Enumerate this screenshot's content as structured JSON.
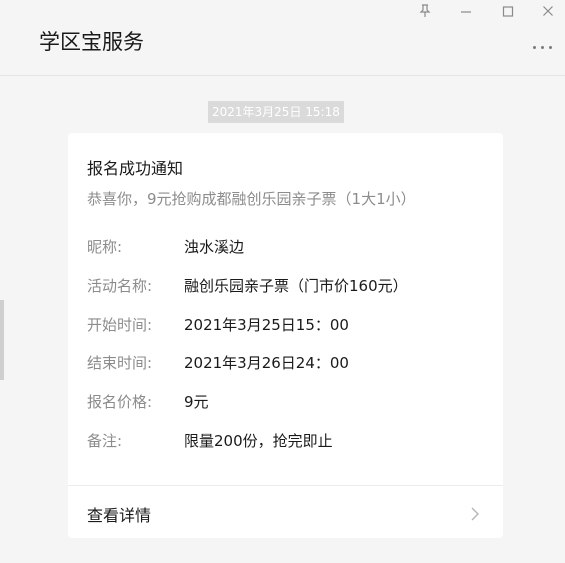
{
  "window": {
    "title": "学区宝服务",
    "controls": [
      "pin-icon",
      "minimize-icon",
      "maximize-icon",
      "close-icon"
    ]
  },
  "message": {
    "timestamp": "2021年3月25日 15:18",
    "card": {
      "title": "报名成功通知",
      "subtitle": "恭喜你，9元抢购成都融创乐园亲子票（1大1小）",
      "fields": [
        {
          "label": "昵称:",
          "value": "浊水溪边"
        },
        {
          "label": "活动名称:",
          "value": "融创乐园亲子票（门市价160元）"
        },
        {
          "label": "开始时间:",
          "value": "2021年3月25日15：00"
        },
        {
          "label": "结束时间:",
          "value": "2021年3月26日24：00"
        },
        {
          "label": "报名价格:",
          "value": "9元"
        },
        {
          "label": "备注:",
          "value": "限量200份，抢完即止"
        }
      ],
      "detail_label": "查看详情"
    }
  },
  "colors": {
    "background": "#f5f5f5",
    "card": "#ffffff",
    "label_gray": "#8c8c8c",
    "text_dark": "#1a1a1a"
  }
}
